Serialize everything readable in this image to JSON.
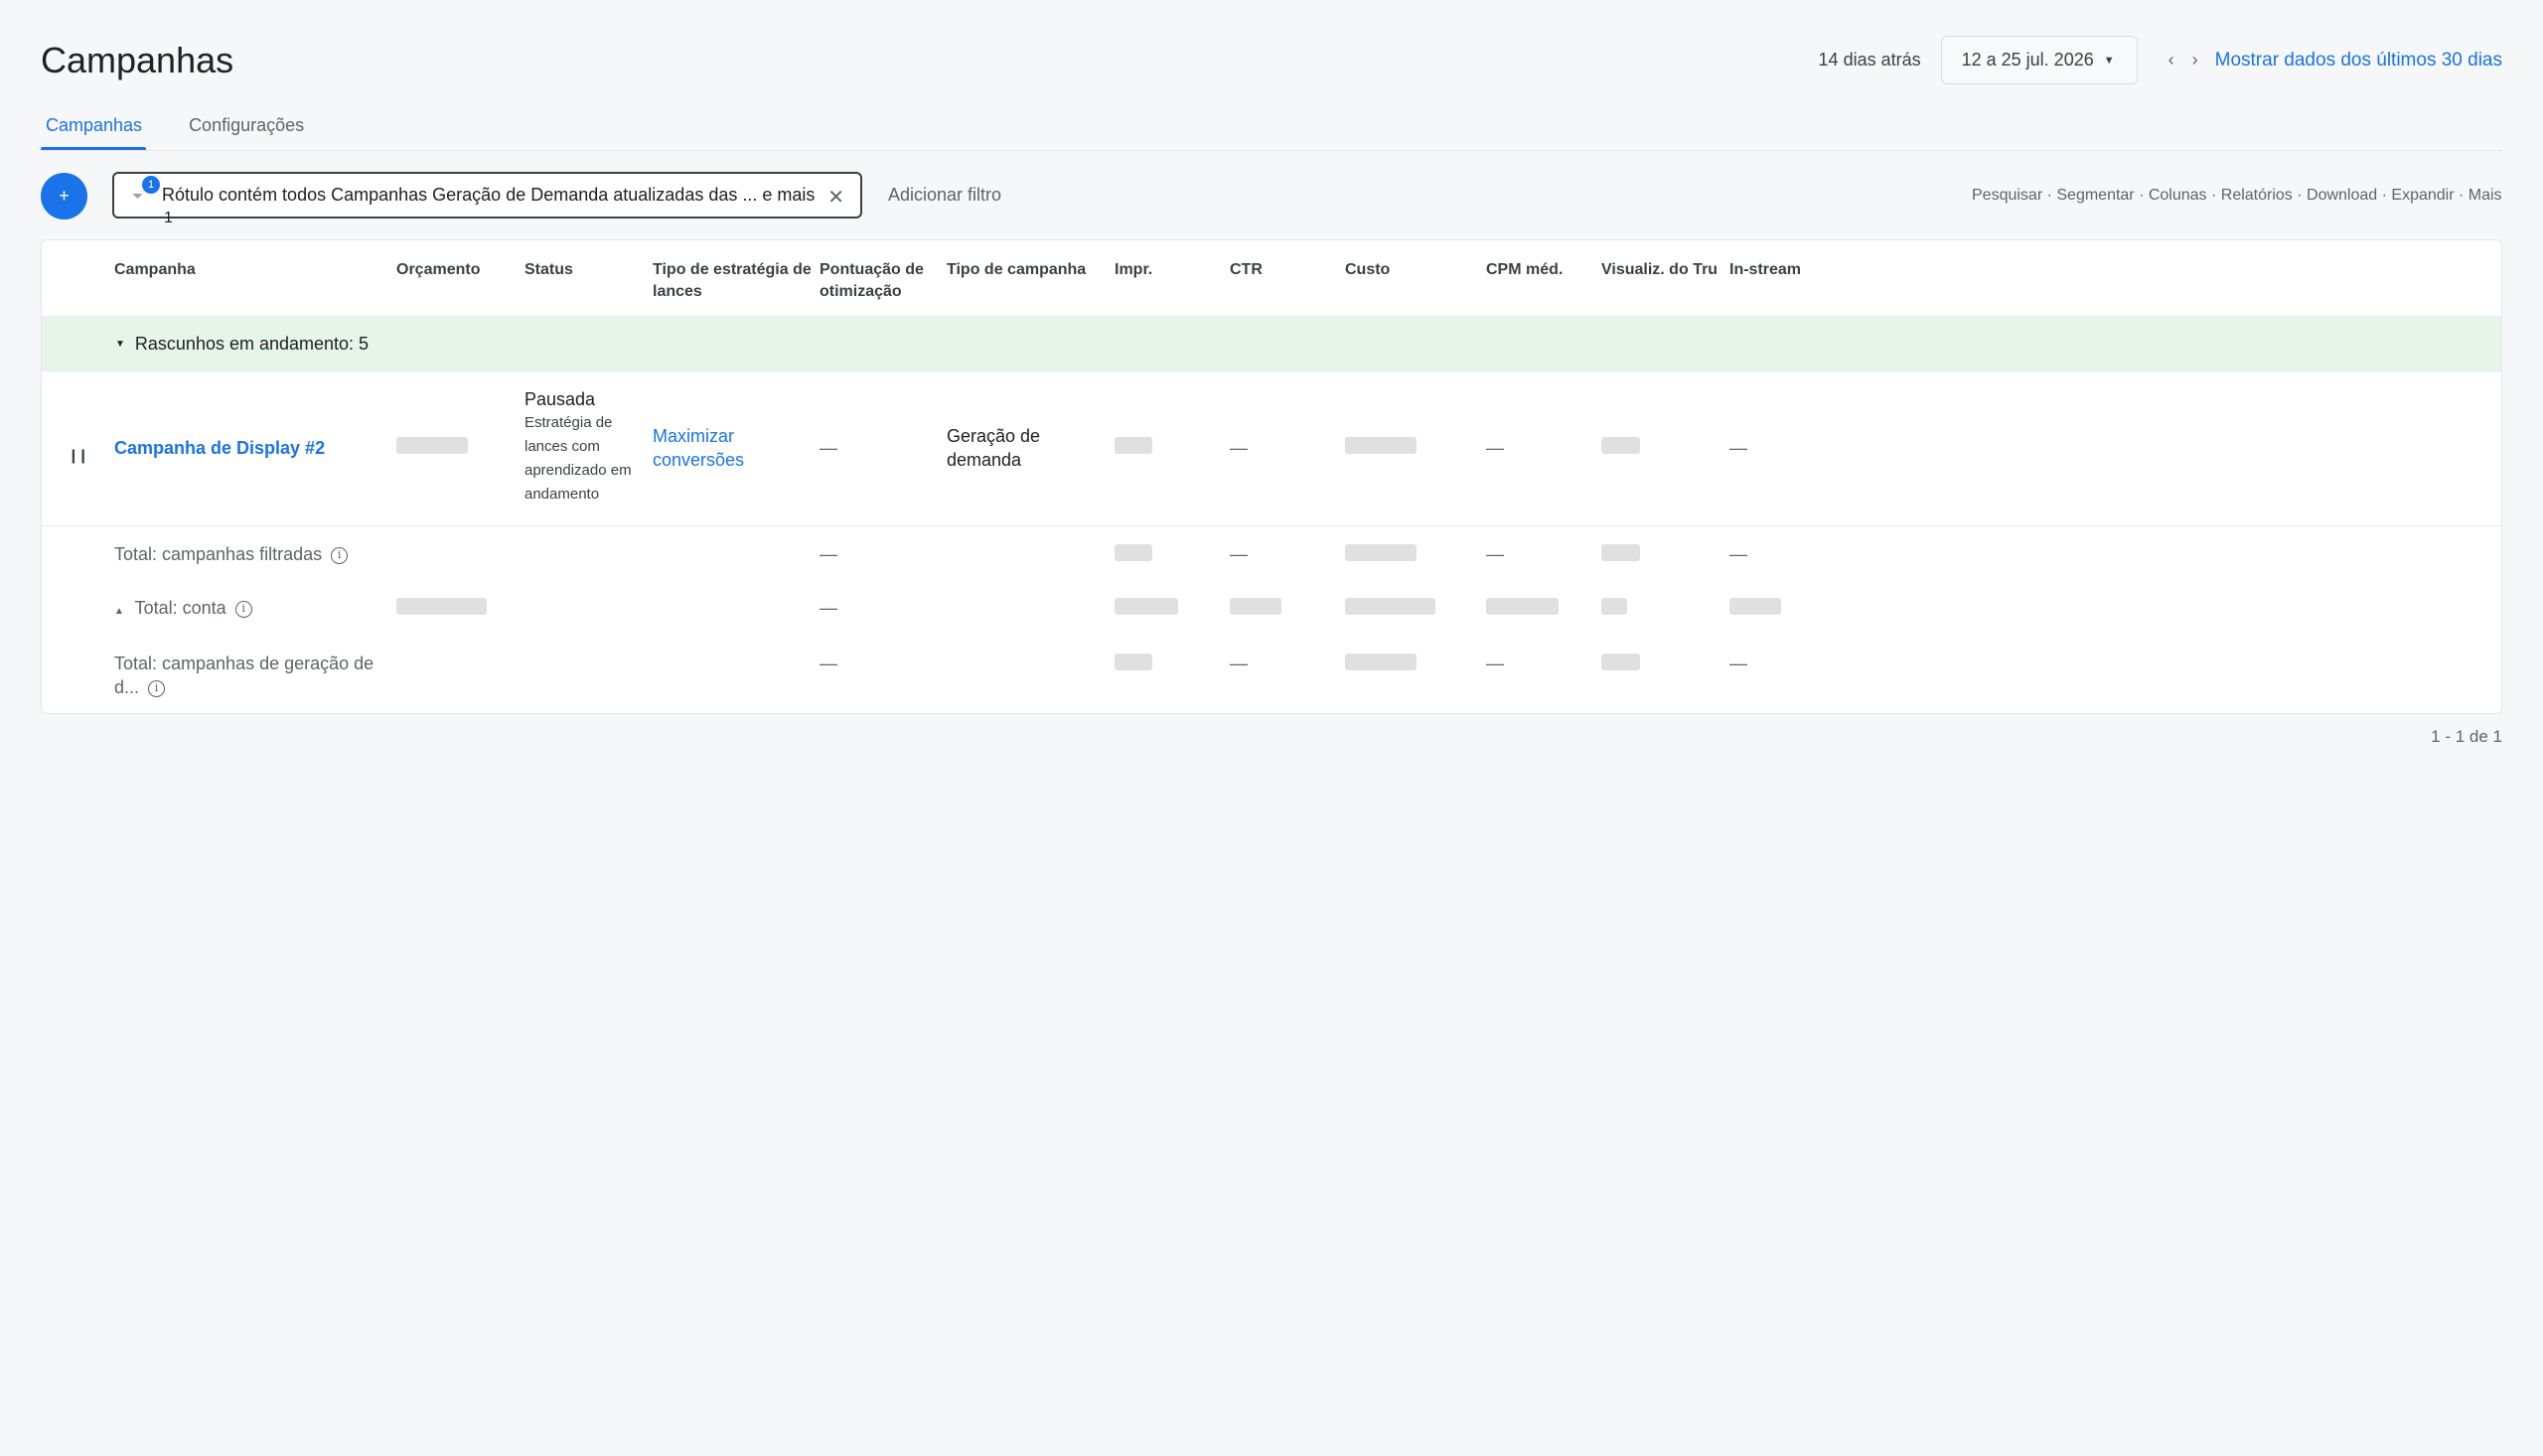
{
  "header": {
    "title": "Campanhas",
    "days_ago": "14 dias atrás",
    "date_range": "12 a 25 jul. 2026",
    "prev_label": "‹",
    "next_label": "›",
    "last30_link": "Mostrar dados dos últimos 30 dias"
  },
  "tabs": [
    {
      "label": "Campanhas",
      "active": true
    },
    {
      "label": "Configurações",
      "active": false
    }
  ],
  "filter": {
    "add_button_label": "+",
    "chip_text": "Rótulo contém todos Campanhas Geração de Demanda atualizadas das ... e mais",
    "chip_badge": "1",
    "chip_count": "1",
    "add_filter_label": "Adicionar filtro"
  },
  "toolbar": {
    "items": "Pesquisar · Segmentar · Colunas · Relatórios · Download · Expandir · Mais"
  },
  "table": {
    "columns": [
      "Campanha",
      "Orçamento",
      "Status",
      "Tipo de estratégia de lances",
      "Pontuação de otimização",
      "Tipo de campanha",
      "Impr.",
      "CTR",
      "Custo",
      "CPM méd.",
      "Visualiz. do Tru",
      "In-stream"
    ],
    "group_label": "Rascunhos em andamento: 5",
    "rows": [
      {
        "campaign": "Campanha de Display #2",
        "status": "Pausada",
        "status_detail": "Estratégia de lances com aprendizado em andamento",
        "bid_strategy": "Maximizar conversões",
        "optimization_score": "—",
        "campaign_type": "Geração de demanda",
        "ctr": "—",
        "cpm": "—",
        "instream": "—"
      }
    ],
    "totals": [
      {
        "label": "Total: campanhas filtradas",
        "optimization_score": "—",
        "ctr": "—",
        "cpm": "—",
        "instream": "—"
      },
      {
        "label": "Total: conta",
        "optimization_score": "—"
      },
      {
        "label": "Total: campanhas de geração de d...",
        "optimization_score": "—",
        "ctr": "—",
        "cpm": "—",
        "instream": "—"
      }
    ]
  },
  "pagination": "1 - 1 de 1",
  "colors": {
    "accent": "#1a73e8",
    "group_bg": "#e6f4ea",
    "placeholder": "#e0e0e0"
  }
}
